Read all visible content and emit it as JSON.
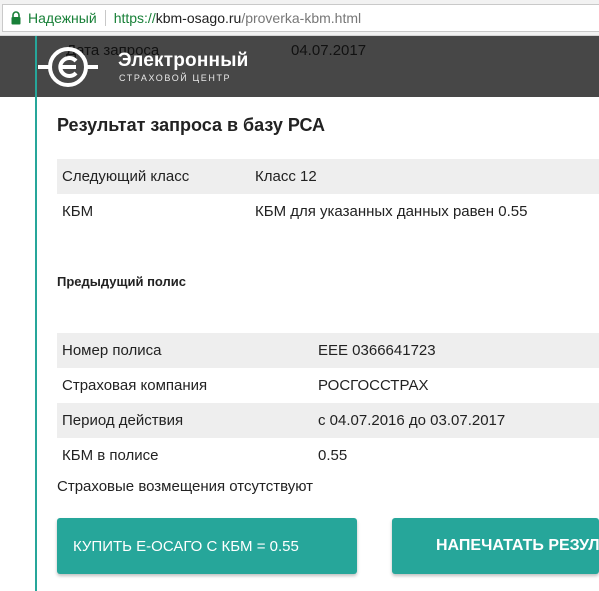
{
  "browser": {
    "secure_label": "Надежный",
    "url_scheme": "https://",
    "url_host": "kbm-osago.ru",
    "url_path": "/proverka-kbm.html"
  },
  "header": {
    "logo_line1": "Электронный",
    "logo_line2": "СТРАХОВОЙ ЦЕНТР",
    "peek_label": "Дата запроса",
    "peek_value": "04.07.2017"
  },
  "result": {
    "title": "Результат запроса в базу РСА",
    "rows": [
      {
        "label": "Следующий класс",
        "value": "Класс 12"
      },
      {
        "label": "КБМ",
        "value": "КБМ для указанных данных равен 0.55"
      }
    ]
  },
  "previous_policy": {
    "heading": "Предыдущий полис",
    "rows": [
      {
        "label": "Номер полиса",
        "value": "ЕЕЕ 0366641723"
      },
      {
        "label": "Страховая компания",
        "value": "РОСГОССТРАХ"
      },
      {
        "label": "Период действия",
        "value": "с 04.07.2016 до 03.07.2017"
      },
      {
        "label": "КБМ в полисе",
        "value": "0.55"
      }
    ],
    "claims_note": "Страховые возмещения отсутствуют"
  },
  "actions": {
    "buy_label": "Купить Е-ОСАГО с КБМ = 0.55",
    "print_label": "Напечатать результат"
  },
  "colors": {
    "accent": "#26a69a",
    "header_bg": "#474747",
    "row_shade": "#eeeeee",
    "secure_green": "#188038"
  },
  "icons": {
    "lock": "lock-icon",
    "logo": "logo-mark-icon"
  }
}
